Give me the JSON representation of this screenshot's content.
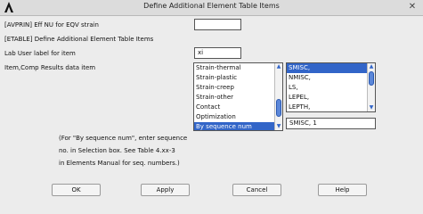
{
  "window": {
    "title": "Define Additional Element Table Items",
    "close_glyph": "✕",
    "app_icon": "ansys-logo-icon"
  },
  "fields": {
    "avprin_label": "[AVPRIN]  Eff NU for EQV strain",
    "avprin_value": "",
    "etable_label": "[ETABLE]  Define Additional Element Table Items",
    "lab_label": "Lab      User label for item",
    "lab_value": "xi",
    "item_label": "Item,Comp  Results data item"
  },
  "item_list": {
    "rows": [
      "Strain-thermal",
      "Strain-plastic",
      "Strain-creep",
      "Strain-other",
      "Contact",
      "Optimization",
      "By sequence num"
    ],
    "selected": "By sequence num"
  },
  "comp_list": {
    "rows": [
      "SMISC,",
      "NMISC,",
      "LS,",
      "LEPEL,",
      "LEPTH,"
    ],
    "selected": "SMISC,"
  },
  "comp_value": "SMISC, 1",
  "note": {
    "line1": "(For \"By sequence num\", enter sequence",
    "line2": "no. in Selection box.  See Table 4.xx-3",
    "line3": "in Elements Manual for seq. numbers.)"
  },
  "buttons": {
    "ok": "OK",
    "apply": "Apply",
    "cancel": "Cancel",
    "help": "Help"
  }
}
